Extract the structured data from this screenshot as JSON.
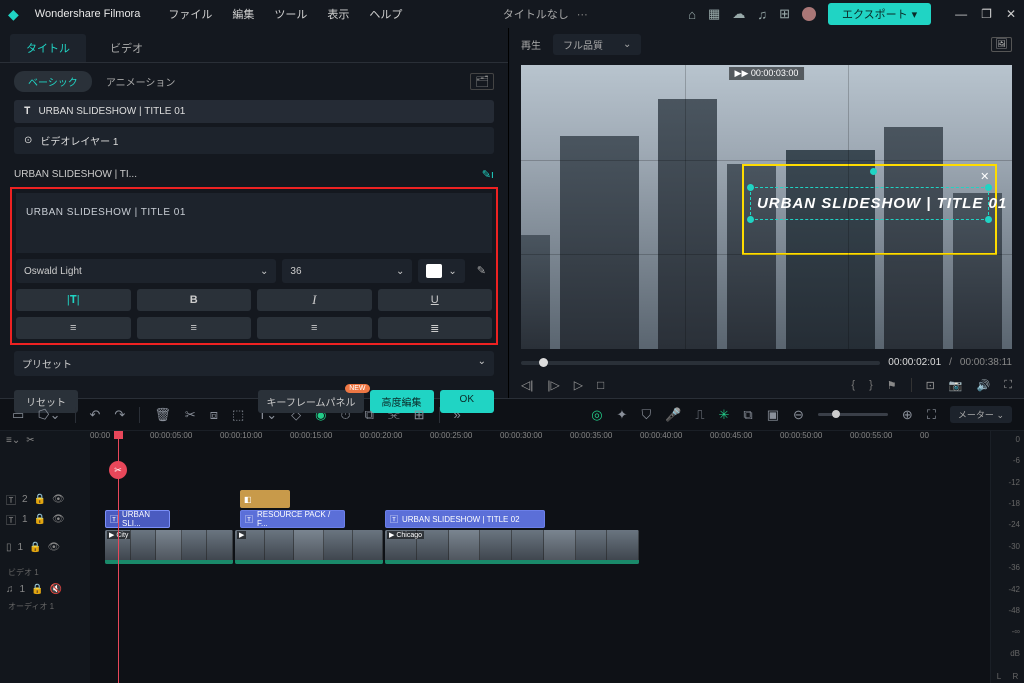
{
  "app": {
    "name": "Wondershare Filmora",
    "doc_title": "タイトルなし",
    "export_label": "エクスポート"
  },
  "menu": [
    "ファイル",
    "編集",
    "ツール",
    "表示",
    "ヘルプ"
  ],
  "panel_tabs": {
    "title": "タイトル",
    "video": "ビデオ"
  },
  "sub_tabs": {
    "basic": "ベーシック",
    "animation": "アニメーション"
  },
  "layers": [
    {
      "icon": "T",
      "label": "URBAN SLIDESHOW | TITLE 01"
    },
    {
      "icon": "⊙",
      "label": "ビデオレイヤー 1"
    }
  ],
  "section_title": "URBAN SLIDESHOW | TI...",
  "text_value": "URBAN SLIDESHOW | TITLE 01",
  "font": {
    "name": "Oswald Light",
    "size": "36"
  },
  "format_btns": {
    "spacing": "|T|",
    "bold": "B",
    "italic": "I",
    "underline": "U"
  },
  "preset_label": "プリセット",
  "buttons": {
    "reset": "リセット",
    "keyframe": "キーフレームパネル",
    "new_badge": "NEW",
    "advanced": "高度編集",
    "ok": "OK"
  },
  "preview": {
    "tab": "再生",
    "quality": "フル品質",
    "overlay_tc": "▶▶ 00:00:03:00",
    "title_text": "URBAN SLIDESHOW | TITLE 01",
    "current": "00:00:02:01",
    "total": "00:00:38:11"
  },
  "timeline": {
    "ruler": [
      "00:00",
      "00:00:05:00",
      "00:00:10:00",
      "00:00:15:00",
      "00:00:20:00",
      "00:00:25:00",
      "00:00:30:00",
      "00:00:35:00",
      "00:00:40:00",
      "00:00:45:00",
      "00:00:50:00",
      "00:00:55:00",
      "00"
    ],
    "meter_label": "メーター",
    "meter_ticks": [
      "0",
      "-6",
      "-12",
      "-18",
      "-24",
      "-30",
      "-36",
      "-42",
      "-48",
      "-∞"
    ],
    "meter_unit": "dB",
    "meter_lr": [
      "L",
      "R"
    ],
    "tracks": {
      "t2": "2",
      "t1": "1",
      "video1": "ビデオ 1",
      "audio1": "1",
      "audio_lbl": "オーディオ 1"
    },
    "clips": {
      "text1": "URBAN SLI...",
      "text2": "RESOURCE PACK / F...",
      "text3": "URBAN SLIDESHOW | TITLE 02",
      "vid1": "City",
      "vid2": "",
      "vid3": "Chicago"
    }
  }
}
